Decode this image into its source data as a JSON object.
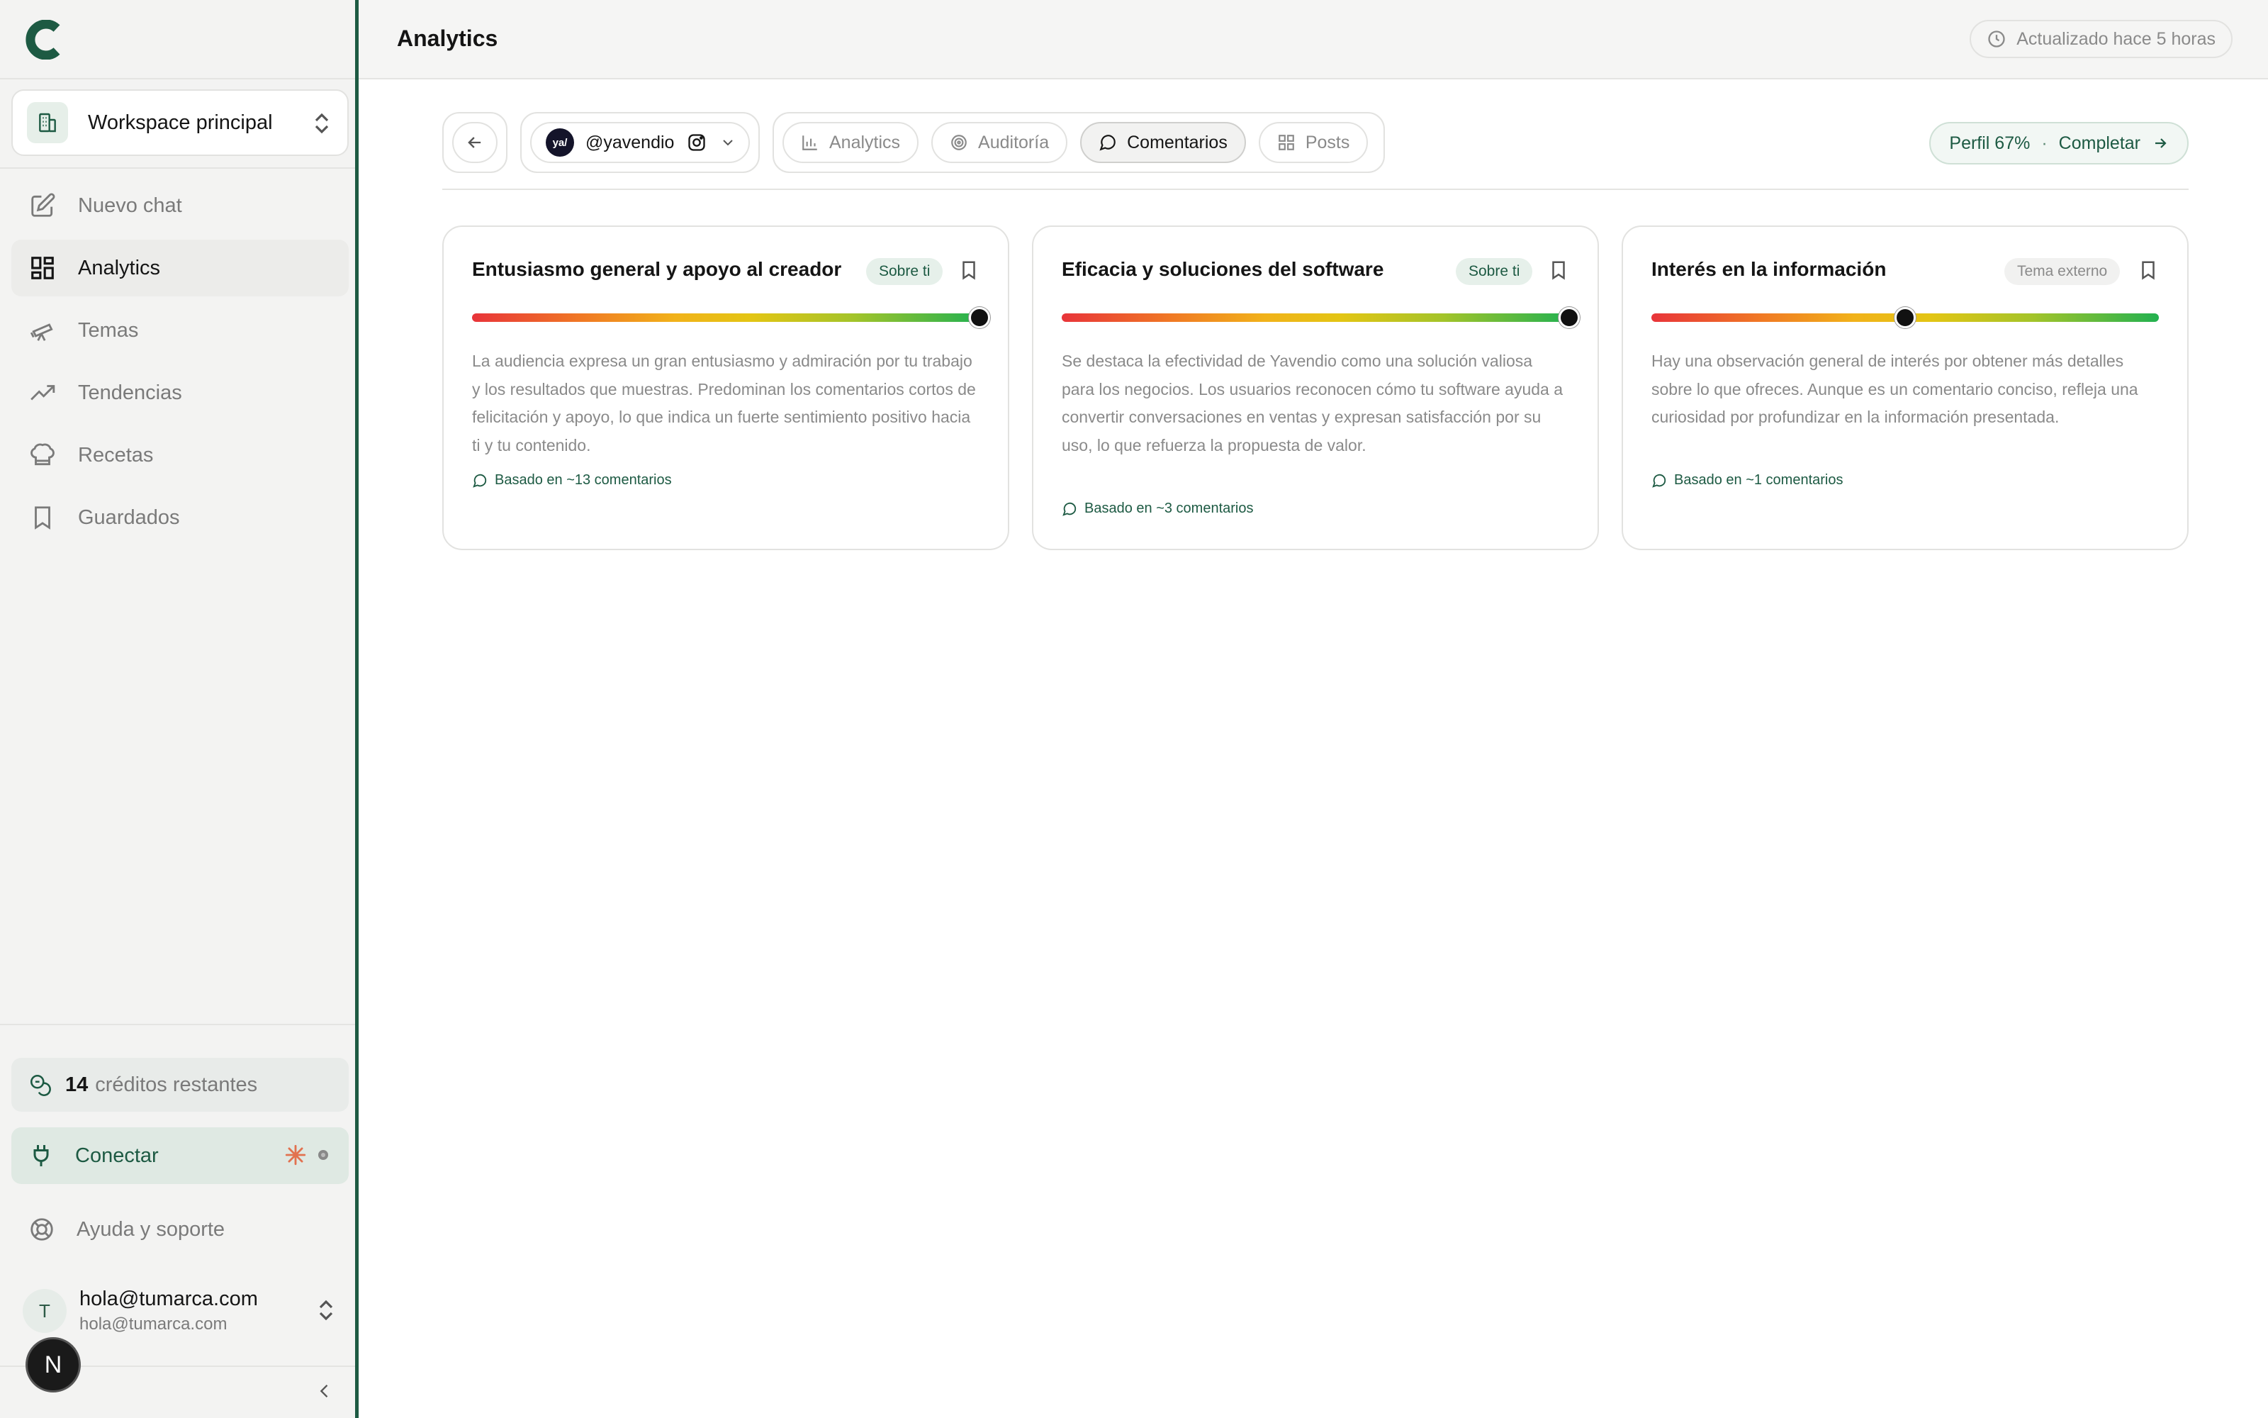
{
  "sidebar": {
    "workspace": "Workspace principal",
    "nav": [
      {
        "label": "Nuevo chat",
        "icon": "edit-icon",
        "active": false
      },
      {
        "label": "Analytics",
        "icon": "dashboard-icon",
        "active": true
      },
      {
        "label": "Temas",
        "icon": "telescope-icon",
        "active": false
      },
      {
        "label": "Tendencias",
        "icon": "trending-icon",
        "active": false
      },
      {
        "label": "Recetas",
        "icon": "chef-hat-icon",
        "active": false
      },
      {
        "label": "Guardados",
        "icon": "bookmark-icon",
        "active": false
      }
    ],
    "credits": {
      "count": "14",
      "label": "créditos restantes"
    },
    "connect": "Conectar",
    "help": "Ayuda y soporte",
    "user": {
      "initial": "T",
      "name": "hola@tumarca.com",
      "email": "hola@tumarca.com"
    },
    "next_badge": "N"
  },
  "topbar": {
    "title": "Analytics",
    "updated": "Actualizado hace 5 horas"
  },
  "toolbar": {
    "account": {
      "avatar_text": "ya/",
      "handle": "@yavendio"
    },
    "tabs": [
      {
        "label": "Analytics",
        "icon": "bar-chart-icon",
        "active": false
      },
      {
        "label": "Auditoría",
        "icon": "target-icon",
        "active": false
      },
      {
        "label": "Comentarios",
        "icon": "comment-icon",
        "active": true
      },
      {
        "label": "Posts",
        "icon": "grid-icon",
        "active": false
      }
    ],
    "profile": {
      "label": "Perfil 67%",
      "separator": "·",
      "action": "Completar"
    }
  },
  "cards": [
    {
      "title": "Entusiasmo general y apoyo al creador",
      "badge": "Sobre ti",
      "badge_style": "green",
      "sentiment": 1.0,
      "text": "La audiencia expresa un gran entusiasmo y admiración por tu trabajo y los resultados que muestras. Predominan los comentarios cortos de felicitación y apoyo, lo que indica un fuerte sentimiento positivo hacia ti y tu contenido.",
      "footer": "Basado en ~13 comentarios"
    },
    {
      "title": "Eficacia y soluciones del software",
      "badge": "Sobre ti",
      "badge_style": "green",
      "sentiment": 1.0,
      "text": "Se destaca la efectividad de Yavendio como una solución valiosa para los negocios. Los usuarios reconocen cómo tu software ayuda a convertir conversaciones en ventas y expresan satisfacción por su uso, lo que refuerza la propuesta de valor.",
      "footer": "Basado en ~3 comentarios"
    },
    {
      "title": "Interés en la información",
      "badge": "Tema externo",
      "badge_style": "gray",
      "sentiment": 0.5,
      "text": "Hay una observación general de interés por obtener más detalles sobre lo que ofreces. Aunque es un comentario conciso, refleja una curiosidad por profundizar en la información presentada.",
      "footer": "Basado en ~1 comentarios"
    }
  ],
  "colors": {
    "brand": "#1d5a43",
    "muted": "#8a8a8a",
    "text": "#151515"
  }
}
